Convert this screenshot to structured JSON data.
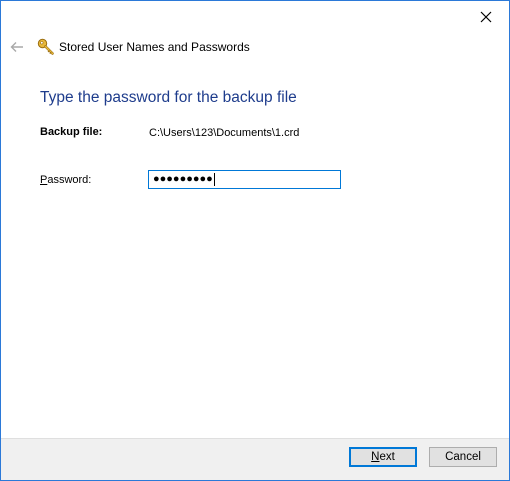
{
  "window": {
    "title": "Stored User Names and Passwords"
  },
  "dialog": {
    "main_instruction": "Type the password for the backup file",
    "backup_file_label": "Backup file:",
    "backup_file_value": "C:\\Users\\123\\Documents\\1.crd",
    "password_label_mnemonic": "P",
    "password_label_rest": "assword:",
    "password_masked": "●●●●●●●●●"
  },
  "footer": {
    "next_mnemonic": "N",
    "next_rest": "ext",
    "cancel_label": "Cancel"
  },
  "icons": {
    "close": "close-icon",
    "back": "back-arrow-icon",
    "app": "key-icon"
  },
  "colors": {
    "instruction": "#1e3c8c",
    "accent": "#0078d7"
  }
}
